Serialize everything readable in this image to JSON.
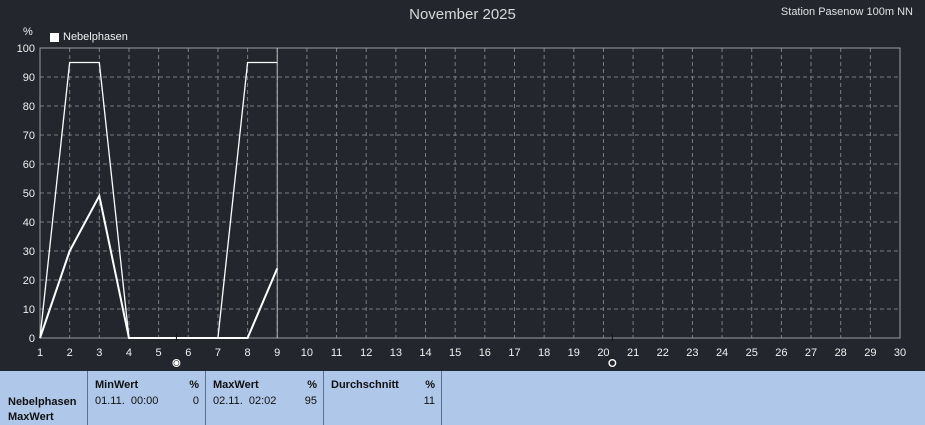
{
  "header": {
    "title": "November 2025",
    "station": "Station Pasenow 100m NN",
    "y_unit": "%"
  },
  "colors": {
    "background": "#23272d",
    "grid": "#7a7d82",
    "series": "#ffffff",
    "stats_panel": "#afc7e9"
  },
  "chart_data": {
    "type": "line",
    "title": "November 2025",
    "ylabel": "%",
    "xlim": [
      1,
      30
    ],
    "ylim": [
      0,
      100
    ],
    "x_ticks": [
      1,
      2,
      3,
      4,
      5,
      6,
      7,
      8,
      9,
      10,
      11,
      12,
      13,
      14,
      15,
      16,
      17,
      18,
      19,
      20,
      21,
      22,
      23,
      24,
      25,
      26,
      27,
      28,
      29,
      30
    ],
    "y_ticks": [
      0,
      10,
      20,
      30,
      40,
      50,
      60,
      70,
      80,
      90,
      100
    ],
    "grid": true,
    "legend_position": "top-left",
    "series": [
      {
        "name": "Nebelphasen",
        "style": "max",
        "x": [
          1,
          2,
          3,
          4,
          5,
          6,
          7,
          8,
          9
        ],
        "y": [
          0,
          95,
          95,
          0,
          0,
          0,
          0,
          95,
          95
        ]
      },
      {
        "style": "mean",
        "x": [
          1,
          2,
          3,
          4,
          5,
          6,
          7,
          8,
          9
        ],
        "y": [
          0,
          30,
          49,
          0,
          0,
          0,
          0,
          0,
          24
        ]
      }
    ],
    "moon_phases": [
      {
        "day": 5.6,
        "phase": "full-moon"
      },
      {
        "day": 20.3,
        "phase": "new-moon"
      }
    ]
  },
  "stats": {
    "row_label_1": "Nebelphasen",
    "row_label_2": "MaxWert",
    "min": {
      "header": "MinWert",
      "unit": "%",
      "date": "01.11.  00:00",
      "value": "0"
    },
    "max": {
      "header": "MaxWert",
      "unit": "%",
      "date": "02.11.  02:02",
      "value": "95"
    },
    "avg": {
      "header": "Durchschnitt",
      "unit": "%",
      "value": "11"
    }
  }
}
